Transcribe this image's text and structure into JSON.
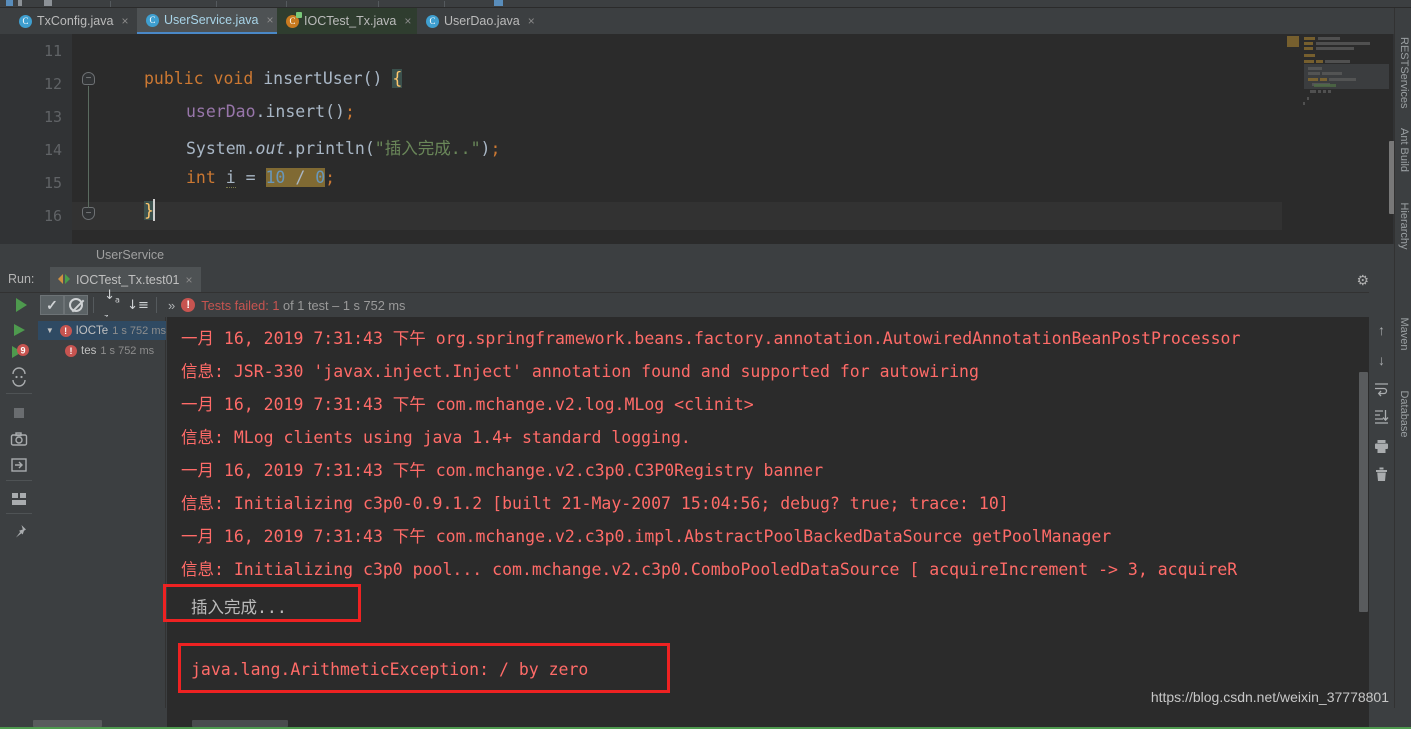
{
  "window": {
    "editor_tabs": [
      {
        "label": "TxConfig.java",
        "icon": "java-class-icon",
        "state": "inactive",
        "close": "×"
      },
      {
        "label": "UserService.java",
        "icon": "java-class-icon",
        "state": "selected",
        "close": "×"
      },
      {
        "label": "IOCTest_Tx.java",
        "icon": "java-class-modified-icon",
        "state": "modified",
        "close": "×"
      },
      {
        "label": "UserDao.java",
        "icon": "java-class-icon",
        "state": "inactive",
        "close": "×"
      }
    ]
  },
  "editor": {
    "line_numbers": [
      "11",
      "12",
      "13",
      "14",
      "15",
      "16"
    ],
    "lines": [
      {
        "n": "11",
        "text": ""
      },
      {
        "n": "12",
        "text": "    public void insertUser() {"
      },
      {
        "n": "13",
        "text": "        userDao.insert();"
      },
      {
        "n": "14",
        "text": "        System.out.println(\"插入完成..\");"
      },
      {
        "n": "15",
        "text": "        int i = 10 / 0;"
      },
      {
        "n": "16",
        "text": "    }"
      }
    ],
    "tokens": {
      "kw_public": "public",
      "kw_void": "void",
      "method_name": "insertUser",
      "parens": "()",
      "brace_open": "{",
      "field_userDao": "userDao",
      "dot": ".",
      "call_insert": "insert",
      "semicolon": ";",
      "cls_System": "System",
      "static_out": "out",
      "call_println": "println",
      "string_literal": "\"插入完成..\"",
      "kw_int": "int",
      "var_i": "i",
      "eq": "=",
      "num_10": "10",
      "slash": "/",
      "num_0": "0",
      "brace_close": "}"
    },
    "breadcrumb": "UserService"
  },
  "run_window": {
    "run_label": "Run:",
    "tab": {
      "label": "IOCTest_Tx.test01",
      "icon": "run-config-icon",
      "close": "×"
    },
    "header_icons": [
      {
        "name": "gear-icon",
        "glyph": "⚙"
      },
      {
        "name": "minimize-icon",
        "glyph": "—"
      }
    ],
    "toolbar": {
      "rerun_icon": "run-icon",
      "show_passed_icon": "check-icon",
      "hide_ignored_icon": "ban-icon",
      "sort_alpha_icon": "sort-alphabetically-icon",
      "sort_duration_icon": "sort-by-duration-icon",
      "expand_icon": "»",
      "status_badge": "!",
      "status_prefix": "Tests failed: ",
      "status_count": "1",
      "status_mid": " of ",
      "status_total": "1",
      "status_suffix": " test – ",
      "status_time": "1 s 752 ms"
    },
    "side_actions": [
      {
        "name": "rerun-tests-icon",
        "glyph": "run"
      },
      {
        "name": "rerun-failed-tests-icon",
        "glyph": "run-failed"
      },
      {
        "name": "toggle-auto-test-icon",
        "glyph": "auto-test"
      },
      {
        "name": "stop-icon",
        "glyph": "stop"
      },
      {
        "name": "export-snapshot-icon",
        "glyph": "camera"
      },
      {
        "name": "import-tests-icon",
        "glyph": "import"
      },
      {
        "name": "layout-icon",
        "glyph": "layout"
      },
      {
        "name": "pin-tab-icon",
        "glyph": "pin"
      }
    ],
    "console_actions": [
      {
        "name": "up-the-stack-trace-icon",
        "glyph": "↑"
      },
      {
        "name": "down-the-stack-trace-icon",
        "glyph": "↓"
      },
      {
        "name": "soft-wrap-icon",
        "glyph": "↵"
      },
      {
        "name": "scroll-to-end-icon",
        "glyph": "⤓"
      },
      {
        "name": "print-icon",
        "glyph": "⎙"
      },
      {
        "name": "clear-all-icon",
        "glyph": "🗑"
      }
    ]
  },
  "test_tree": {
    "rows": [
      {
        "indent": 0,
        "arrow": "▼",
        "status": "failed",
        "label": "IOCTe",
        "time": "1 s 752 ms",
        "selected": true
      },
      {
        "indent": 1,
        "arrow": "",
        "status": "failed",
        "label": "tes",
        "time": "1 s 752 ms",
        "selected": false
      }
    ]
  },
  "console": {
    "lines": [
      {
        "text": "一月 16, 2019 7:31:43 下午 org.springframework.beans.factory.annotation.AutowiredAnnotationBeanPostProcessor",
        "style": "error"
      },
      {
        "text": "信息: JSR-330 'javax.inject.Inject' annotation found and supported for autowiring",
        "style": "error"
      },
      {
        "text": "一月 16, 2019 7:31:43 下午 com.mchange.v2.log.MLog <clinit>",
        "style": "error"
      },
      {
        "text": "信息: MLog clients using java 1.4+ standard logging.",
        "style": "error"
      },
      {
        "text": "一月 16, 2019 7:31:43 下午 com.mchange.v2.c3p0.C3P0Registry banner",
        "style": "error"
      },
      {
        "text": "信息: Initializing c3p0-0.9.1.2 [built 21-May-2007 15:04:56; debug? true; trace: 10]",
        "style": "error"
      },
      {
        "text": "一月 16, 2019 7:31:43 下午 com.mchange.v2.c3p0.impl.AbstractPoolBackedDataSource getPoolManager",
        "style": "error"
      },
      {
        "text": "信息: Initializing c3p0 pool... com.mchange.v2.c3p0.ComboPooledDataSource [ acquireIncrement -> 3, acquireR",
        "style": "error"
      },
      {
        "text": "插入完成...",
        "style": "stdout"
      },
      {
        "text": "java.lang.ArithmeticException: / by zero",
        "style": "error"
      }
    ]
  },
  "annotations": {
    "box1_target": "插入完成...",
    "box2_target": "java.lang.ArithmeticException: / by zero",
    "box_color": "#ee2222"
  },
  "right_tool_tabs": [
    {
      "label": "RESTServices",
      "icon": "rest-services-icon"
    },
    {
      "label": "Ant Build",
      "icon": "ant-build-icon"
    },
    {
      "label": "Hierarchy",
      "icon": "hierarchy-icon"
    },
    {
      "label": "Maven",
      "icon": "maven-icon"
    },
    {
      "label": "Database",
      "icon": "database-icon"
    }
  ],
  "watermark": "https://blog.csdn.net/weixin_37778801",
  "colors": {
    "ide_chrome": "#3c3f41",
    "editor_bg": "#2b2b2b",
    "gutter_bg": "#313335",
    "console_error": "#ff6b68",
    "console_stdout": "#bbbbbb",
    "accent_blue": "#4a88c7",
    "fail_red": "#c75450",
    "annotation_red": "#ee2222",
    "keyword_orange": "#cc7832",
    "string_green": "#6a8759",
    "number_blue": "#6897bb",
    "field_purple": "#9876aa"
  }
}
